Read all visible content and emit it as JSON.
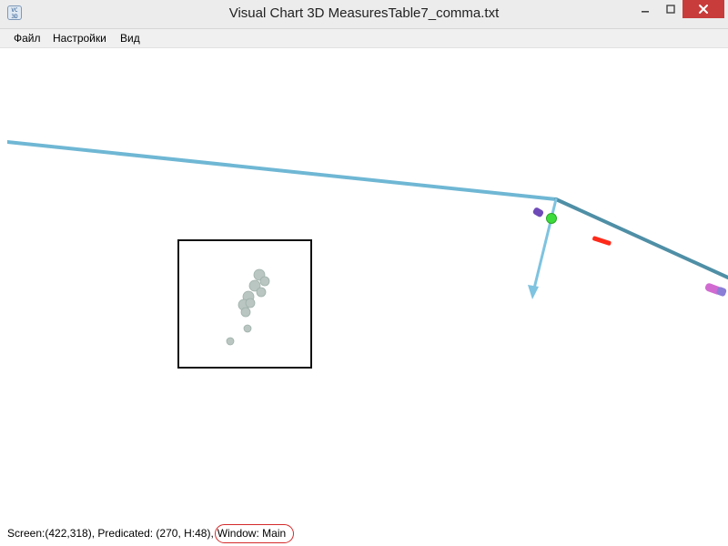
{
  "window": {
    "title": "Visual Chart 3D MeasuresTable7_comma.txt",
    "app_icon_text": "VC\n3D"
  },
  "menu": {
    "file": "Файл",
    "settings": "Настройки",
    "view": "Вид"
  },
  "status": {
    "screen_label": "Screen:(422,318), Predicated: (270, H:48),",
    "window_label": "Window: Main"
  },
  "scene": {
    "axis_color": "#6fb7d4",
    "axis_color_dark": "#4f8fa6",
    "marker_red": "#ff2a1a",
    "marker_green": "#3ddc3d",
    "marker_purple": "#6e4ab8",
    "marker_pink": "#d16bd1",
    "cluster_color": "#b9c6c1"
  }
}
